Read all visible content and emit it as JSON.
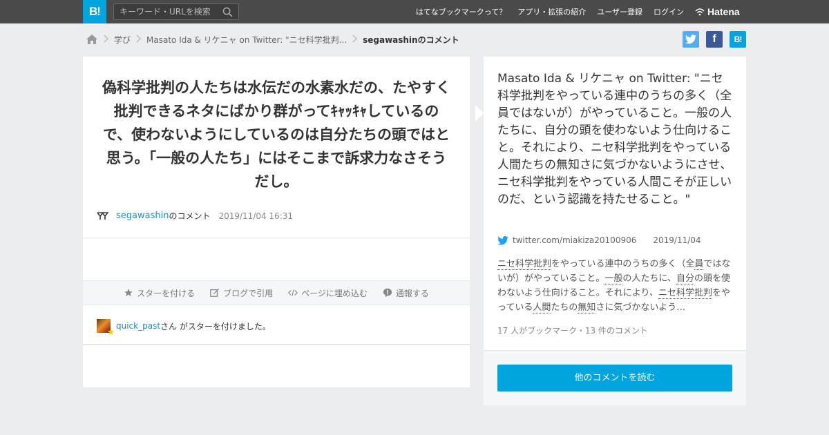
{
  "header": {
    "logo": "B!",
    "search_placeholder": "キーワード・URLを検索",
    "nav": [
      "はてなブックマークって？",
      "アプリ・拡張の紹介",
      "ユーザー登録",
      "ログイン"
    ],
    "brand": "Hatena",
    "bg_color": "#4a4a4a",
    "accent_color": "#00a4de"
  },
  "breadcrumb": {
    "home_icon": "home-icon",
    "items": [
      "学び",
      "Masato Ida & リケニャ on Twitter: \"ニセ科学批判...",
      "segawashinのコメント"
    ]
  },
  "share": {
    "twitter": "twitter-icon",
    "facebook_label": "f",
    "hatena_label": "B!"
  },
  "comment": {
    "text": "偽科学批判の人たちは水伝だの水素水だの、たやすく批判できるネタにばかり群がってｷｬｯｷｬしているので、使わないようにしているのは自分たちの頭ではと思う。「一般の人たち」にはそこまで訴求力なさそうだし。",
    "user": "segawashin",
    "user_suffix": "のコメント",
    "date": "2019/11/04 16:31"
  },
  "actions": {
    "star": "スターを付ける",
    "blog": "ブログで引用",
    "embed": "ページに埋め込む",
    "report": "通報する"
  },
  "stars": {
    "user": "quick_past",
    "text": "さん がスターを付けました。"
  },
  "entry": {
    "title": "Masato Ida & リケニャ on Twitter: \"ニセ科学批判をやっている連中のうちの多く（全員ではないが）がやっていること。一般の人たちに、自分の頭を使わないよう仕向けること。それにより、ニセ科学批判をやっている人間たちの無知さに気づかないようにさせ、ニセ科学批判をやっている人間こそが正しいのだ、という認識を持たせること。\"",
    "domain": "twitter.com/miakiza20100906",
    "date": "2019/11/04",
    "summary": {
      "s1": "ニセ科学批判",
      "s2": "をやっている連中のうちの多く（全",
      "s3": "員",
      "s4": "ではないが）がやっていること。",
      "s5": "一般",
      "s6": "の人たちに、",
      "s7": "自分",
      "s8": "の頭を使わないよう仕向けること。それにより、",
      "s9": "ニセ科学批判",
      "s10": "をやっている",
      "s11": "人間",
      "s12": "たちの",
      "s13": "無知",
      "s14": "さに気づかないよう…"
    },
    "counts": "17 人がブックマーク・13 件のコメント",
    "more_button": "他のコメントを読む"
  }
}
